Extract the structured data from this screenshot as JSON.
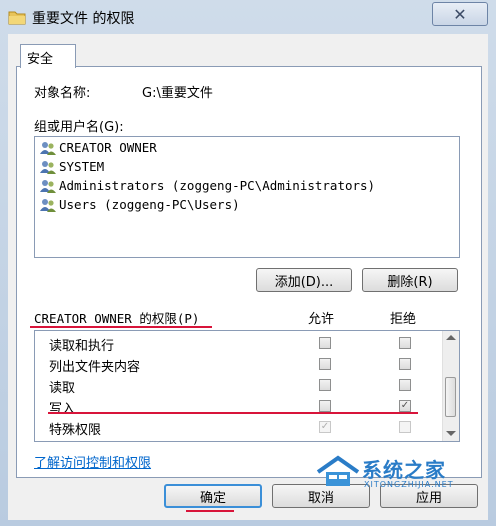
{
  "window": {
    "title": "重要文件 的权限",
    "close_glyph": "✕"
  },
  "tabs": [
    {
      "label": "安全"
    }
  ],
  "object": {
    "label": "对象名称:",
    "value": "G:\\重要文件"
  },
  "users": {
    "label": "组或用户名(G):",
    "items": [
      "CREATOR OWNER",
      "SYSTEM",
      "Administrators (zoggeng-PC\\Administrators)",
      "Users (zoggeng-PC\\Users)"
    ]
  },
  "buttons": {
    "add": "添加(D)...",
    "remove": "删除(R)",
    "ok": "确定",
    "cancel": "取消",
    "apply": "应用"
  },
  "permissions": {
    "label": "CREATOR OWNER 的权限(P)",
    "allow_header": "允许",
    "deny_header": "拒绝",
    "items": [
      {
        "name": "读取和执行",
        "allow": false,
        "deny": false,
        "allow_disabled": false,
        "deny_disabled": false
      },
      {
        "name": "列出文件夹内容",
        "allow": false,
        "deny": false,
        "allow_disabled": false,
        "deny_disabled": false
      },
      {
        "name": "读取",
        "allow": false,
        "deny": false,
        "allow_disabled": false,
        "deny_disabled": false
      },
      {
        "name": "写入",
        "allow": false,
        "deny": true,
        "allow_disabled": false,
        "deny_disabled": false
      },
      {
        "name": "特殊权限",
        "allow": true,
        "deny": false,
        "allow_disabled": true,
        "deny_disabled": true
      }
    ]
  },
  "help_link": "了解访问控制和权限",
  "watermark": {
    "text": "系统之家",
    "url_text": "XITONGZHIJIA.NET"
  },
  "colors": {
    "annotation_red": "#d8143a",
    "link_blue": "#0066cc"
  }
}
